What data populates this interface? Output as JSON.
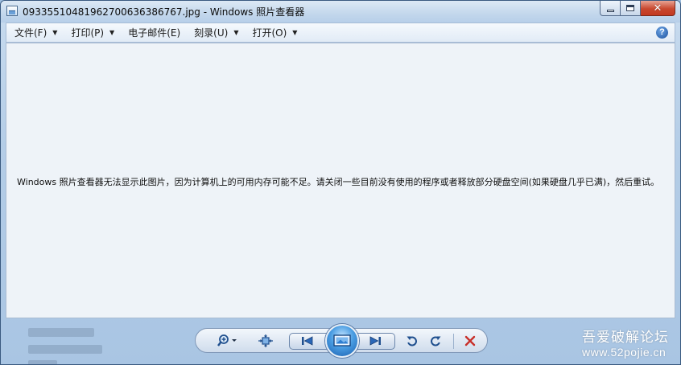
{
  "window": {
    "title": "09335510481962700636386767.jpg - Windows 照片查看器"
  },
  "menu": {
    "items": [
      {
        "label": "文件(F)"
      },
      {
        "label": "打印(P)"
      },
      {
        "label": "电子邮件(E)"
      },
      {
        "label": "刻录(U)"
      },
      {
        "label": "打开(O)"
      }
    ],
    "help_icon": "help-icon"
  },
  "content": {
    "message": "Windows 照片查看器无法显示此图片，因为计算机上的可用内存可能不足。请关闭一些目前没有使用的程序或者释放部分硬盘空间(如果硬盘几乎已满)，然后重试。"
  },
  "toolbar": {
    "icons": [
      "zoom-icon",
      "actual-size-icon",
      "previous-icon",
      "slideshow-icon",
      "next-icon",
      "rotate-left-icon",
      "rotate-right-icon",
      "delete-icon"
    ],
    "delete_color": "#c8302a",
    "accent_color": "#1a5fb0"
  },
  "watermark": {
    "title": "吾爱破解论坛",
    "url": "www.52pojie.cn"
  }
}
